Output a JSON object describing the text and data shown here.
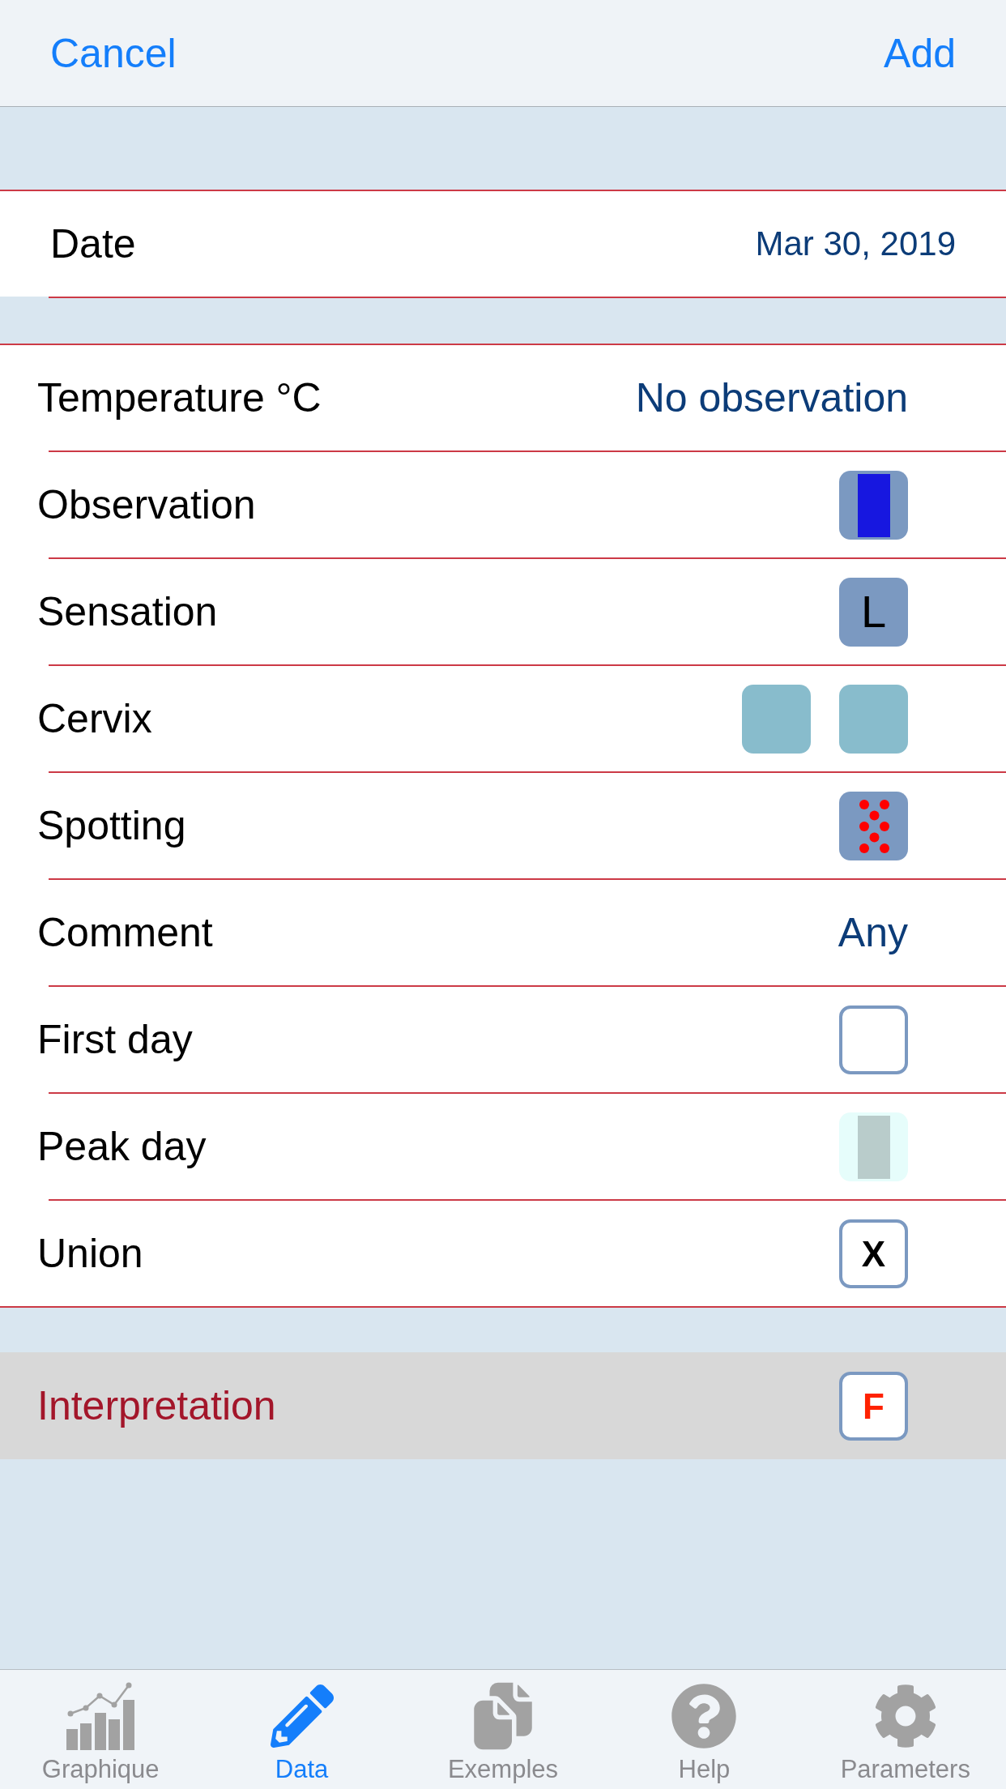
{
  "navigation_bar": {
    "left_button": "Cancel",
    "right_button": "Add"
  },
  "date": {
    "label": "Date",
    "value": "Mar 30, 2019"
  },
  "rows": [
    {
      "kind": "text",
      "label": "Temperature °C",
      "value": "No observation"
    },
    {
      "kind": "tiles",
      "label": "Observation",
      "tiles": [
        {
          "kind": "solid",
          "color": "#7b99c1",
          "content": {
            "kind": "bar",
            "color": "#1717e0"
          }
        }
      ]
    },
    {
      "kind": "tiles",
      "label": "Sensation",
      "tiles": [
        {
          "kind": "solid",
          "color": "#7b99c1",
          "content": {
            "kind": "letter",
            "text": "L",
            "color": "#000000"
          }
        }
      ]
    },
    {
      "kind": "tiles",
      "label": "Cervix",
      "tiles": [
        {
          "kind": "solid",
          "color": "#88bccc"
        },
        {
          "kind": "solid",
          "color": "#88bccc"
        }
      ]
    },
    {
      "kind": "tiles",
      "label": "Spotting",
      "tiles": [
        {
          "kind": "solid",
          "color": "#7b99c1",
          "content": {
            "kind": "dots",
            "color": "#ff0000"
          }
        }
      ]
    },
    {
      "kind": "text",
      "label": "Comment",
      "value": "Any"
    },
    {
      "kind": "tiles",
      "label": "First day",
      "tiles": [
        {
          "kind": "outline"
        }
      ]
    },
    {
      "kind": "tiles",
      "label": "Peak day",
      "tiles": [
        {
          "kind": "solid",
          "color": "#e6fdfb",
          "content": {
            "kind": "bar",
            "color": "#b9cccb"
          }
        }
      ]
    },
    {
      "kind": "tiles",
      "label": "Union",
      "tiles": [
        {
          "kind": "outline",
          "content": {
            "kind": "letter",
            "text": "X",
            "color": "#000000"
          }
        }
      ]
    }
  ],
  "interpretation": {
    "label": "Interpretation",
    "tiles": [
      {
        "kind": "outline",
        "content": {
          "kind": "letter",
          "text": "F",
          "color": "#ff2200"
        }
      }
    ]
  },
  "tabs": [
    {
      "label": "Graphique",
      "selected": false
    },
    {
      "label": "Data",
      "selected": true
    },
    {
      "label": "Exemples",
      "selected": false
    },
    {
      "label": "Help",
      "selected": false
    },
    {
      "label": "Parameters",
      "selected": false
    }
  ]
}
